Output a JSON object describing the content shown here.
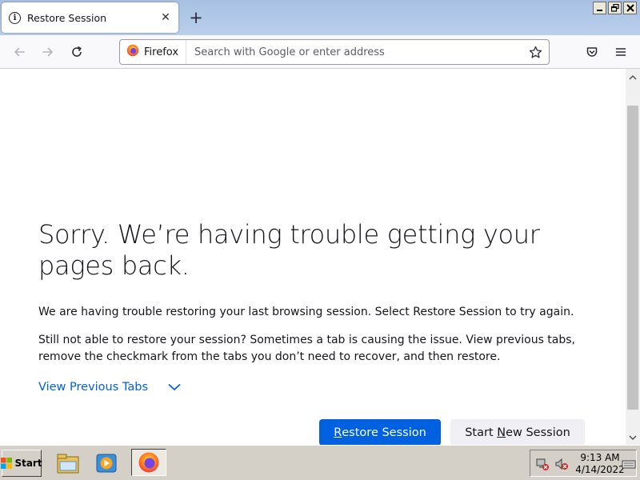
{
  "browser": {
    "tab": {
      "title": "Restore Session",
      "info_icon": "info-icon",
      "close_icon": "close-icon"
    },
    "new_tab_icon": "plus-icon",
    "window_controls": {
      "minimize": "minimize-icon",
      "restore": "restore-icon",
      "close": "close-icon"
    },
    "toolbar": {
      "back_icon": "arrow-left-icon",
      "forward_icon": "arrow-right-icon",
      "reload_icon": "reload-icon",
      "identity_label": "Firefox",
      "url_placeholder": "Search with Google or enter address",
      "bookmark_icon": "star-icon",
      "pocket_icon": "pocket-icon",
      "menu_icon": "hamburger-menu-icon"
    }
  },
  "page": {
    "title": "Sorry. We’re having trouble getting your pages back.",
    "message1": "We are having trouble restoring your last browsing session. Select Restore Session to try again.",
    "message2": "Still not able to restore your session? Sometimes a tab is causing the issue. View previous tabs, remove the checkmark from the tabs you don’t need to recover, and then restore.",
    "view_previous_tabs": "View Previous Tabs",
    "restore_button": {
      "accesskey": "R",
      "rest": "estore Session"
    },
    "new_session_button": {
      "before": "Start ",
      "accesskey": "N",
      "rest": "ew Session"
    }
  },
  "taskbar": {
    "start_label": "Start",
    "quick_launch": [
      "file-manager-icon",
      "media-player-icon",
      "firefox-icon"
    ],
    "tray": {
      "icons": [
        "network-disconnected-icon",
        "volume-muted-icon"
      ],
      "time": "9:13 AM",
      "date": "4/14/2022",
      "keyboard_icon": "keyboard-icon"
    }
  },
  "colors": {
    "accent": "#0061e0",
    "link": "#0060df",
    "tabstrip": "#b3cbea",
    "taskbar": "#d4d0c8"
  }
}
